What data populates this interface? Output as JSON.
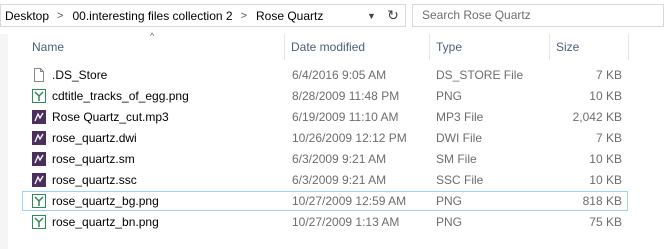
{
  "address": {
    "crumbs": [
      "Desktop",
      "00.interesting files collection 2",
      "Rose Quartz"
    ],
    "separator": ">",
    "dropdown_icon": "chevron-down-icon",
    "refresh_icon": "refresh-icon"
  },
  "search": {
    "placeholder": "Search Rose Quartz"
  },
  "columns": {
    "name": "Name",
    "date": "Date modified",
    "type": "Type",
    "size": "Size",
    "sort_indicator": "^"
  },
  "files": [
    {
      "name": ".DS_Store",
      "date": "6/4/2016 9:05 AM",
      "type": "DS_STORE File",
      "size": "7 KB",
      "icon": "blank-file-icon"
    },
    {
      "name": "cdtitle_tracks_of_egg.png",
      "date": "8/28/2009 11:48 PM",
      "type": "PNG",
      "size": "10 KB",
      "icon": "image-file-icon"
    },
    {
      "name": "Rose Quartz_cut.mp3",
      "date": "6/19/2009 11:10 AM",
      "type": "MP3 File",
      "size": "2,042 KB",
      "icon": "media-file-icon"
    },
    {
      "name": "rose_quartz.dwi",
      "date": "10/26/2009 12:12 PM",
      "type": "DWI File",
      "size": "7 KB",
      "icon": "media-file-icon"
    },
    {
      "name": "rose_quartz.sm",
      "date": "6/3/2009 9:21 AM",
      "type": "SM File",
      "size": "10 KB",
      "icon": "media-file-icon"
    },
    {
      "name": "rose_quartz.ssc",
      "date": "6/3/2009 9:21 AM",
      "type": "SSC File",
      "size": "10 KB",
      "icon": "media-file-icon"
    },
    {
      "name": "rose_quartz_bg.png",
      "date": "10/27/2009 12:59 AM",
      "type": "PNG",
      "size": "818 KB",
      "icon": "image-file-icon",
      "selected": true
    },
    {
      "name": "rose_quartz_bn.png",
      "date": "10/27/2009 1:13 AM",
      "type": "PNG",
      "size": "75 KB",
      "icon": "image-file-icon"
    }
  ],
  "colors": {
    "header_text": "#4c607a",
    "detail_text": "#6d6d6d",
    "selection_border": "#99d1ff",
    "media_icon": "#4a2e5c",
    "image_icon": "#2e8b57"
  }
}
